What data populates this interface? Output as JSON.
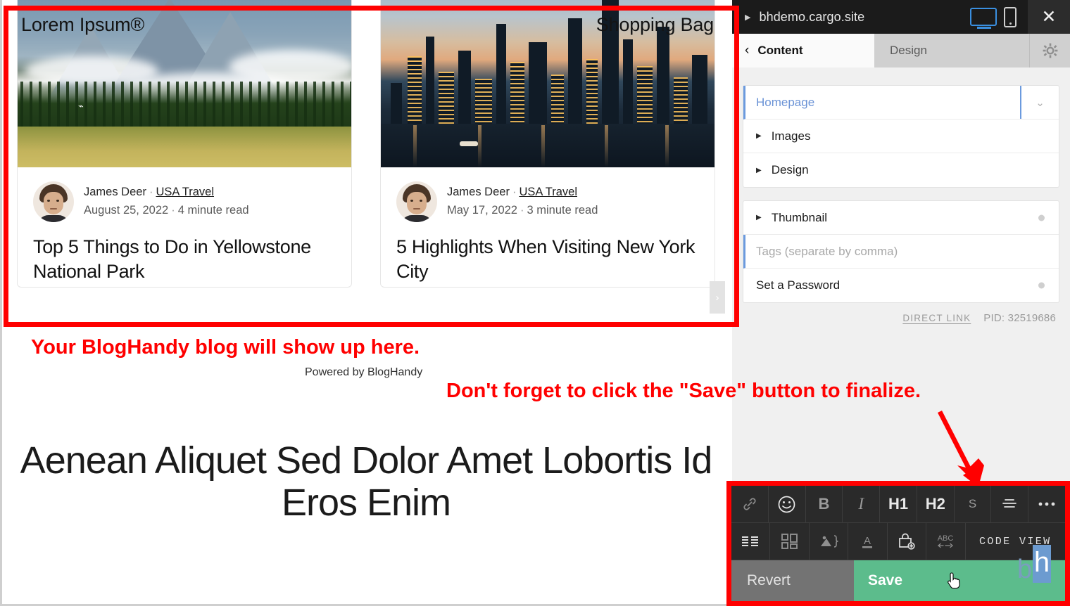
{
  "preview": {
    "site_nav_left": "Lorem Ipsum®",
    "site_nav_right": "Shopping Bag",
    "cards": [
      {
        "author": "James Deer",
        "category": "USA Travel",
        "date": "August 25, 2022",
        "read_time": "4 minute read",
        "title": "Top 5 Things to Do in Yellowstone National Park",
        "photo": "mountain-forest-photo"
      },
      {
        "author": "James Deer",
        "category": "USA Travel",
        "date": "May 17, 2022",
        "read_time": "3 minute read",
        "title": "5 Highlights When Visiting New York City",
        "photo": "city-skyline-photo"
      }
    ],
    "slider_next_icon": "chevron-right-icon",
    "powered_by": "Powered by BlogHandy",
    "big_heading": "Aenean Aliquet Sed Dolor Amet Lobortis Id Eros Enim",
    "separator_dot": "·"
  },
  "annotations": {
    "callout_1": "Your BlogHandy blog will show up here.",
    "callout_2": "Don't forget to click the \"Save\" button to finalize.",
    "highlight_color": "#ff0000",
    "arrow_icon": "down-right-arrow-icon"
  },
  "panel": {
    "titlebar": {
      "caret_icon": "triangle-right-icon",
      "url": "bhdemo.cargo.site",
      "desktop_icon": "desktop-view-icon",
      "mobile_icon": "mobile-view-icon",
      "close_icon": "close-icon",
      "desktop_accent": "#3a8fe0"
    },
    "tabs": {
      "back_icon": "chevron-left-icon",
      "content_label": "Content",
      "design_label": "Design",
      "gear_icon": "gear-icon"
    },
    "group_a": [
      {
        "label": "Homepage",
        "type": "selected-dropdown",
        "icon": "chevron-down-icon"
      },
      {
        "label": "Images",
        "type": "expander",
        "icon": "triangle-right-icon"
      },
      {
        "label": "Design",
        "type": "expander",
        "icon": "triangle-right-icon"
      }
    ],
    "group_b": [
      {
        "label": "Thumbnail",
        "type": "expander-toggle",
        "icon": "triangle-right-icon"
      },
      {
        "label": "Tags (separate by comma)",
        "type": "text-input-placeholder"
      },
      {
        "label": "Set a Password",
        "type": "toggle"
      }
    ],
    "meta": {
      "direct_link": "DIRECT LINK",
      "pid_label": "PID:",
      "pid_value": "32519686"
    }
  },
  "toolbar": {
    "row1": [
      {
        "name": "link-icon",
        "glyph": "link"
      },
      {
        "name": "emoji-icon",
        "glyph": "smiley"
      },
      {
        "name": "bold-button",
        "glyph": "B"
      },
      {
        "name": "italic-button",
        "glyph": "I"
      },
      {
        "name": "heading1-button",
        "glyph": "H1"
      },
      {
        "name": "heading2-button",
        "glyph": "H2"
      },
      {
        "name": "strikethrough-button",
        "glyph": "S"
      },
      {
        "name": "align-icon",
        "glyph": "align"
      },
      {
        "name": "more-options-icon",
        "glyph": "…"
      }
    ],
    "row2": [
      {
        "name": "list-icon",
        "glyph": "list"
      },
      {
        "name": "layout-grid-icon",
        "glyph": "grid"
      },
      {
        "name": "insert-image-icon",
        "glyph": "image"
      },
      {
        "name": "underline-button",
        "glyph": "A"
      },
      {
        "name": "add-product-icon",
        "glyph": "bag-plus"
      },
      {
        "name": "spellcheck-icon",
        "glyph": "ABC"
      }
    ],
    "code_view_label": "CODE VIEW",
    "revert_label": "Revert",
    "save_label": "Save",
    "save_color": "#5cbc8c",
    "revert_color": "#737373",
    "cursor_icon": "pointer-hand-cursor",
    "bh_logo": "bh"
  }
}
